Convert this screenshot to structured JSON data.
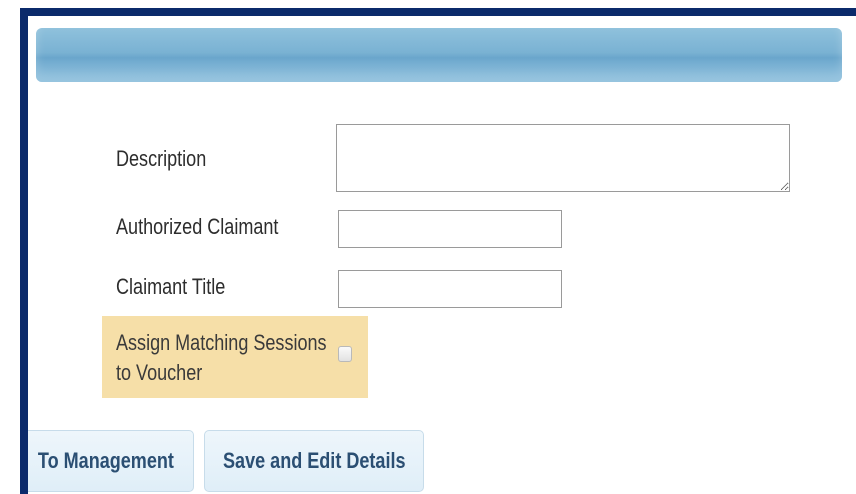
{
  "form": {
    "description": {
      "label": "Description",
      "value": ""
    },
    "authorized_claimant": {
      "label": "Authorized Claimant",
      "value": ""
    },
    "claimant_title": {
      "label": "Claimant Title",
      "value": ""
    },
    "assign_matching": {
      "label_line1": "Assign Matching Sessions",
      "label_line2": "to Voucher",
      "checked": false
    }
  },
  "buttons": {
    "to_management": "To Management",
    "save_and_edit": "Save and Edit Details"
  },
  "colors": {
    "frame": "#0b2a6b",
    "header_bar": "#7ab2d3",
    "highlight": "#f6dfa8",
    "button_text": "#2b4f73"
  }
}
